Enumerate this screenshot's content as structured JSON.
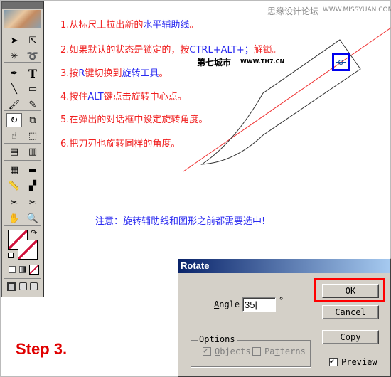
{
  "watermark": {
    "site_cn": "思缘设计论坛",
    "site_url": "WWW.MISSYUAN.COM",
    "th7_cn": "第七城市",
    "th7_url": "WWW.TH7.CN"
  },
  "instructions": [
    [
      {
        "t": "1.从标尺上拉出新的",
        "c": "red"
      },
      {
        "t": "水平辅助线",
        "c": "blue"
      },
      {
        "t": "。",
        "c": "red"
      }
    ],
    [
      {
        "t": "2.如果默认的状态是锁定的，按",
        "c": "red"
      },
      {
        "t": "CTRL+ALT+；",
        "c": "blue"
      },
      {
        "t": "解锁。",
        "c": "red"
      }
    ],
    [
      {
        "t": "3.按",
        "c": "red"
      },
      {
        "t": "R",
        "c": "blue"
      },
      {
        "t": "键切换到",
        "c": "red"
      },
      {
        "t": "旋转工具",
        "c": "blue"
      },
      {
        "t": "。",
        "c": "red"
      }
    ],
    [
      {
        "t": "4.按住",
        "c": "red"
      },
      {
        "t": "ALT",
        "c": "blue"
      },
      {
        "t": "键点击旋转中心点。",
        "c": "red"
      }
    ],
    [
      {
        "t": "5.在弹出的对话框中设定旋转角度。",
        "c": "red"
      }
    ],
    [
      {
        "t": "6.把刀刃也旋转同样的角度。",
        "c": "red"
      }
    ]
  ],
  "note": "注意：旋转辅助线和图形之前都需要选中!",
  "step_label": "Step 3.",
  "dialog": {
    "title": "Rotate",
    "angle_label": "Angle:",
    "angle_value": "35",
    "degree": "°",
    "ok": "OK",
    "cancel": "Cancel",
    "copy": "Copy",
    "options_label": "Options",
    "objects": "Objects",
    "patterns": "Patterns",
    "preview": "Preview",
    "objects_checked": true,
    "patterns_checked": false,
    "preview_checked": true
  },
  "colors": {
    "red": "#f02020",
    "blue": "#2a2af0",
    "highlight": "#ff0000",
    "center_box": "#0000ee"
  },
  "toolbar": {
    "tools": [
      "selection",
      "direct-selection",
      "magic-wand",
      "lasso",
      "pen",
      "type",
      "line",
      "rectangle",
      "paintbrush",
      "pencil",
      "rotate",
      "scale",
      "warp",
      "free-transform",
      "symbol-sprayer",
      "graph",
      "mesh",
      "gradient",
      "measure",
      "blend",
      "knife",
      "scissors",
      "hand",
      "zoom"
    ],
    "selected": "rotate"
  }
}
